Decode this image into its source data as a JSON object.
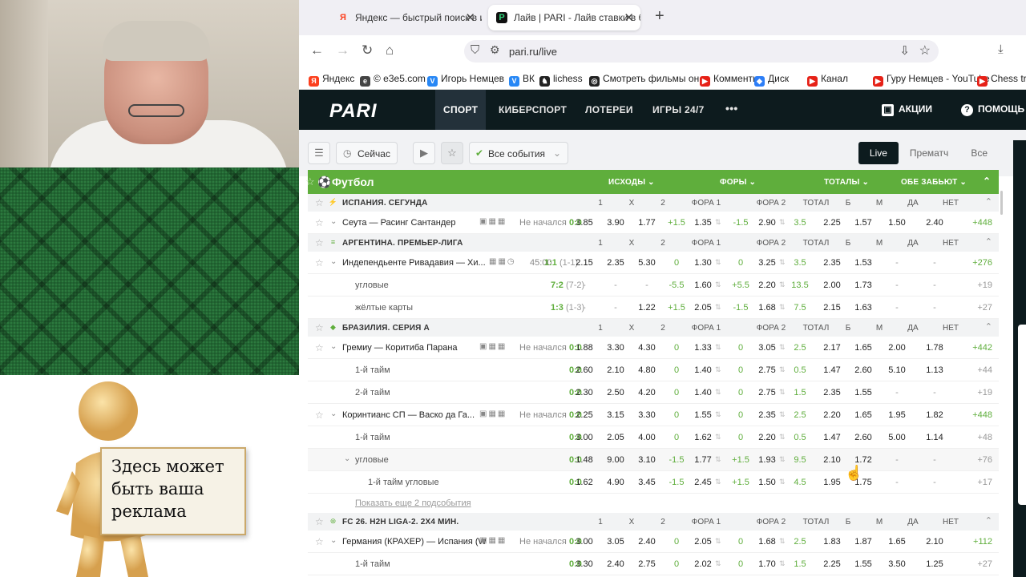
{
  "tabs": [
    {
      "label": "Яндекс — быстрый поиск в ин",
      "favicon": "Я",
      "fav_color": "#fc3f1d",
      "active": false
    },
    {
      "label": "Лайв | PARI - Лайв ставки в бу",
      "favicon": "P",
      "fav_color": "#111",
      "active": true
    }
  ],
  "url": "pari.ru/live",
  "bookmarks": [
    {
      "label": "Яндекс",
      "color": "#fc3f1d",
      "glyph": "Я"
    },
    {
      "label": "© e3e5.com",
      "color": "#444",
      "glyph": "e"
    },
    {
      "label": "Игорь Немцев",
      "color": "#2787f5",
      "glyph": "V"
    },
    {
      "label": "ВК",
      "color": "#2787f5",
      "glyph": "V"
    },
    {
      "label": "lichess",
      "color": "#222",
      "glyph": "♞"
    },
    {
      "label": "Смотреть фильмы он...",
      "color": "#222",
      "glyph": "◎"
    },
    {
      "label": "Комменты",
      "color": "#e62117",
      "glyph": "▶"
    },
    {
      "label": "Диск",
      "color": "#2d7ef7",
      "glyph": "◆"
    },
    {
      "label": "Канал",
      "color": "#e62117",
      "glyph": "▶"
    },
    {
      "label": "Гуру Немцев - YouTube",
      "color": "#e62117",
      "glyph": "▶"
    },
    {
      "label": "Chess trainin",
      "color": "#e62117",
      "glyph": "▶"
    }
  ],
  "ad_text": "Здесь может быть ваша реклама",
  "header": {
    "logo": "PARI",
    "nav": [
      "СПОРТ",
      "КИБЕРСПОРТ",
      "ЛОТЕРЕИ",
      "ИГРЫ 24/7"
    ],
    "more": "•••",
    "promo": "АКЦИИ",
    "help": "ПОМОЩЬ"
  },
  "filter": {
    "now": "Сейчас",
    "all_events": "Все события",
    "modes": [
      "Live",
      "Прематч",
      "Все"
    ]
  },
  "sport": {
    "title": "Футбол",
    "groups": [
      "ИСХОДЫ",
      "ФОРЫ",
      "ТОТАЛЫ",
      "ОБЕ ЗАБЬЮТ"
    ],
    "colheads": [
      "1",
      "X",
      "2",
      "ФОРА 1",
      "ФОРА 2",
      "ТОТАЛ",
      "Б",
      "М",
      "ДА",
      "НЕТ"
    ]
  },
  "leagues": [
    {
      "name": "ИСПАНИЯ. СЕГУНДА",
      "icon": "⚡",
      "events": [
        {
          "name": "Сеута — Расинг Сантандер",
          "status": "Не начался",
          "score": "0:0",
          "scoreb": "",
          "odds": [
            "3.85",
            "3.90",
            "1.77",
            "+1.5",
            "1.35",
            "-1.5",
            "2.90",
            "3.5",
            "2.25",
            "1.57",
            "1.50",
            "2.40"
          ],
          "more": "+448",
          "sub": false
        }
      ]
    },
    {
      "name": "АРГЕНТИНА. ПРЕМЬЕР-ЛИГА",
      "icon": "≡",
      "events": [
        {
          "name": "Индепендьенте Ривадавия — Хи...",
          "status": "45:00",
          "score": "1:1",
          "scoreb": "(1-1)",
          "odds": [
            "2.15",
            "2.35",
            "5.30",
            "0",
            "1.30",
            "0",
            "3.25",
            "3.5",
            "2.35",
            "1.53",
            "-",
            "-"
          ],
          "more": "+276",
          "sub": false
        },
        {
          "name": "угловые",
          "status": "",
          "score": "7:2",
          "scoreb": "(7-2)",
          "odds": [
            "-",
            "-",
            "-",
            "-5.5",
            "1.60",
            "+5.5",
            "2.20",
            "13.5",
            "2.00",
            "1.73",
            "-",
            "-"
          ],
          "more": "+19",
          "sub": true
        },
        {
          "name": "жёлтые карты",
          "status": "",
          "score": "1:3",
          "scoreb": "(1-3)",
          "odds": [
            "-",
            "-",
            "1.22",
            "+1.5",
            "2.05",
            "-1.5",
            "1.68",
            "7.5",
            "2.15",
            "1.63",
            "-",
            "-"
          ],
          "more": "+27",
          "sub": true
        }
      ]
    },
    {
      "name": "БРАЗИЛИЯ. СЕРИЯ А",
      "icon": "◆",
      "events": [
        {
          "name": "Гремиу — Коритиба Парана",
          "status": "Не начался",
          "score": "0:0",
          "scoreb": "",
          "odds": [
            "1.88",
            "3.30",
            "4.30",
            "0",
            "1.33",
            "0",
            "3.05",
            "2.5",
            "2.17",
            "1.65",
            "2.00",
            "1.78"
          ],
          "more": "+442",
          "sub": false
        },
        {
          "name": "1-й тайм",
          "status": "",
          "score": "0:0",
          "scoreb": "",
          "odds": [
            "2.60",
            "2.10",
            "4.80",
            "0",
            "1.40",
            "0",
            "2.75",
            "0.5",
            "1.47",
            "2.60",
            "5.10",
            "1.13"
          ],
          "more": "+44",
          "sub": true
        },
        {
          "name": "2-й тайм",
          "status": "",
          "score": "0:0",
          "scoreb": "",
          "odds": [
            "2.30",
            "2.50",
            "4.20",
            "0",
            "1.40",
            "0",
            "2.75",
            "1.5",
            "2.35",
            "1.55",
            "-",
            "-"
          ],
          "more": "+19",
          "sub": true
        },
        {
          "name": "Коринтианс СП — Васко да Га...",
          "status": "Не начался",
          "score": "0:0",
          "scoreb": "",
          "odds": [
            "2.25",
            "3.15",
            "3.30",
            "0",
            "1.55",
            "0",
            "2.35",
            "2.5",
            "2.20",
            "1.65",
            "1.95",
            "1.82"
          ],
          "more": "+448",
          "sub": false
        },
        {
          "name": "1-й тайм",
          "status": "",
          "score": "0:0",
          "scoreb": "",
          "odds": [
            "3.00",
            "2.05",
            "4.00",
            "0",
            "1.62",
            "0",
            "2.20",
            "0.5",
            "1.47",
            "2.60",
            "5.00",
            "1.14"
          ],
          "more": "+48",
          "sub": true
        },
        {
          "name": "угловые",
          "status": "",
          "score": "0:0",
          "scoreb": "",
          "odds": [
            "1.48",
            "9.00",
            "3.10",
            "-1.5",
            "1.77",
            "+1.5",
            "1.93",
            "9.5",
            "2.10",
            "1.72",
            "-",
            "-"
          ],
          "more": "+76",
          "sub": true,
          "open": true
        },
        {
          "name": "1-й тайм угловые",
          "status": "",
          "score": "0:0",
          "scoreb": "",
          "odds": [
            "1.62",
            "4.90",
            "3.45",
            "-1.5",
            "2.45",
            "+1.5",
            "1.50",
            "4.5",
            "1.95",
            "1.75",
            "-",
            "-"
          ],
          "more": "+17",
          "sub": true,
          "deep": true
        }
      ],
      "show_more": "Показать еще 2 подсобытия"
    },
    {
      "name": "FC 26. H2H LIGA-2. 2X4 МИН.",
      "icon": "⊛",
      "events": [
        {
          "name": "Германия (КРАХЕР) — Испания (W...",
          "status": "Не начался",
          "score": "0:0",
          "scoreb": "",
          "odds": [
            "3.00",
            "3.05",
            "2.40",
            "0",
            "2.05",
            "0",
            "1.68",
            "2.5",
            "1.83",
            "1.87",
            "1.65",
            "2.10"
          ],
          "more": "+112",
          "sub": false
        },
        {
          "name": "1-й тайм",
          "status": "",
          "score": "0:0",
          "scoreb": "",
          "odds": [
            "3.30",
            "2.40",
            "2.75",
            "0",
            "2.02",
            "0",
            "1.70",
            "1.5",
            "2.25",
            "1.55",
            "3.50",
            "1.25"
          ],
          "more": "+27",
          "sub": true
        }
      ]
    }
  ]
}
